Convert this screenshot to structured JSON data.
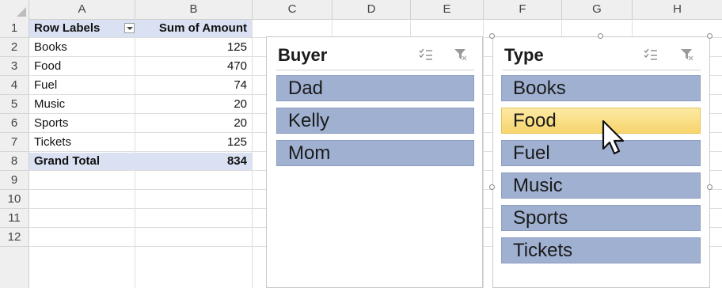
{
  "columns": [
    "A",
    "B",
    "C",
    "D",
    "E",
    "F",
    "G",
    "H"
  ],
  "rows": [
    "1",
    "2",
    "3",
    "4",
    "5",
    "6",
    "7",
    "8",
    "9",
    "10",
    "11",
    "12"
  ],
  "pivot": {
    "header": {
      "label": "Row Labels",
      "value": "Sum of Amount"
    },
    "items": [
      {
        "label": "Books",
        "value": "125"
      },
      {
        "label": "Food",
        "value": "470"
      },
      {
        "label": "Fuel",
        "value": "74"
      },
      {
        "label": "Music",
        "value": "20"
      },
      {
        "label": "Sports",
        "value": "20"
      },
      {
        "label": "Tickets",
        "value": "125"
      }
    ],
    "total": {
      "label": "Grand Total",
      "value": "834"
    }
  },
  "slicers": {
    "buyer": {
      "title": "Buyer",
      "items": [
        "Dad",
        "Kelly",
        "Mom"
      ]
    },
    "type": {
      "title": "Type",
      "items": [
        "Books",
        "Food",
        "Fuel",
        "Music",
        "Sports",
        "Tickets"
      ],
      "hovered": "Food"
    }
  },
  "icons": {
    "multiselect": "multi-select-icon",
    "clear": "clear-filter-icon",
    "cursor": "mouse-pointer-icon"
  },
  "colors": {
    "slicer_item": "#9fb0d0",
    "hover_item": "#f7d56d",
    "pivot_highlight": "#d9e1f2"
  }
}
